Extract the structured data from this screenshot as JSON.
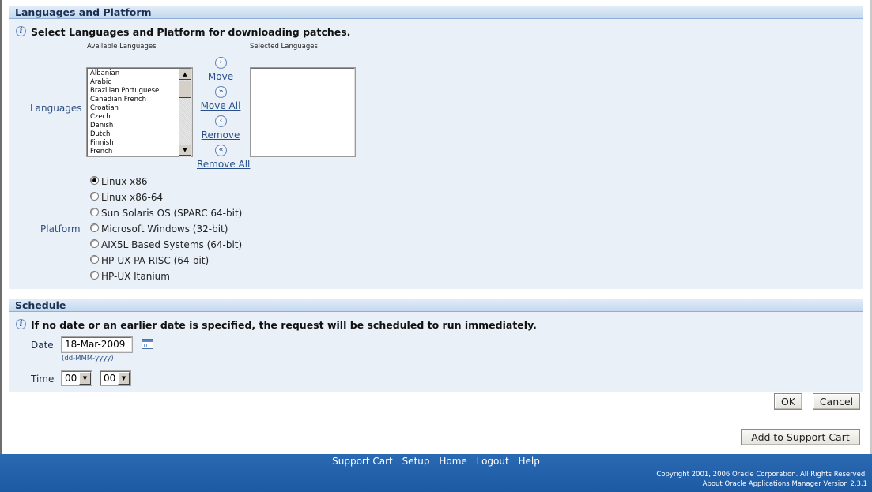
{
  "languages_section": {
    "title": "Languages and Platform",
    "info": "Select Languages and Platform for downloading patches.",
    "available_label": "Available Languages",
    "selected_label": "Selected Languages",
    "languages_label": "Languages",
    "available_languages": [
      "Albanian",
      "Arabic",
      "Brazilian Portuguese",
      "Canadian French",
      "Croatian",
      "Czech",
      "Danish",
      "Dutch",
      "Finnish",
      "French"
    ],
    "shuttle": {
      "move": "Move",
      "move_all": "Move All",
      "remove": "Remove",
      "remove_all": "Remove All"
    },
    "platform_label": "Platform",
    "platforms": [
      "Linux x86",
      "Linux x86-64",
      "Sun Solaris OS (SPARC 64-bit)",
      "Microsoft Windows (32-bit)",
      "AIX5L Based Systems (64-bit)",
      "HP-UX PA-RISC (64-bit)",
      "HP-UX Itanium"
    ],
    "selected_platform": "Linux x86"
  },
  "schedule_section": {
    "title": "Schedule",
    "info": "If no date or an earlier date is specified, the request will be scheduled to run immediately.",
    "date_label": "Date",
    "date_value": "18-Mar-2009",
    "date_hint": "(dd-MMM-yyyy)",
    "time_label": "Time",
    "hour_value": "00",
    "minute_value": "00"
  },
  "buttons": {
    "ok": "OK",
    "cancel": "Cancel",
    "add_to_cart": "Add to Support Cart"
  },
  "footer": {
    "nav": [
      "Support Cart",
      "Setup",
      "Home",
      "Logout",
      "Help"
    ],
    "copyright": "Copyright 2001, 2006 Oracle Corporation. All Rights Reserved.",
    "about": "About Oracle Applications Manager Version 2.3.1"
  },
  "colors": {
    "section_bg": "#eaf0f8",
    "header_text": "#1a2f54",
    "link": "#274f8a",
    "footer_bg": "#2168b0"
  }
}
